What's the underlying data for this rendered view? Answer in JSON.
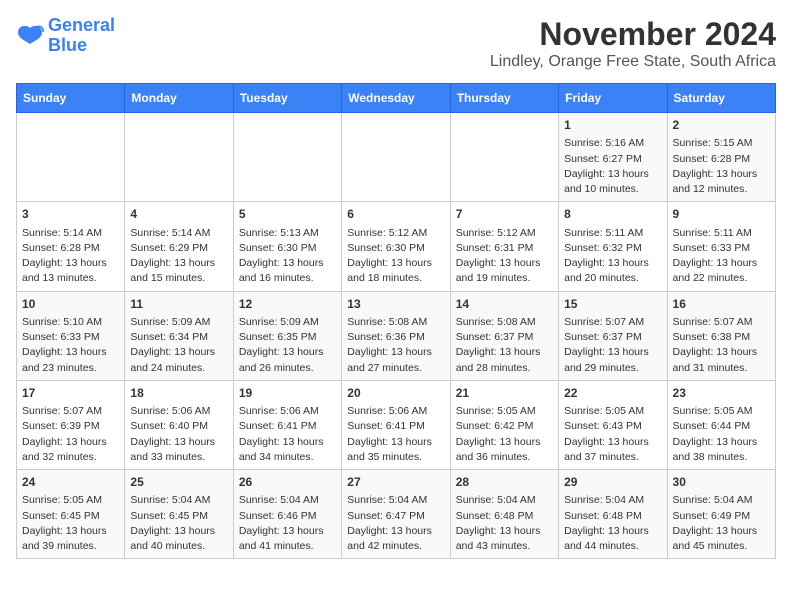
{
  "logo": {
    "line1": "General",
    "line2": "Blue"
  },
  "title": "November 2024",
  "subtitle": "Lindley, Orange Free State, South Africa",
  "days_of_week": [
    "Sunday",
    "Monday",
    "Tuesday",
    "Wednesday",
    "Thursday",
    "Friday",
    "Saturday"
  ],
  "weeks": [
    [
      {
        "day": "",
        "content": ""
      },
      {
        "day": "",
        "content": ""
      },
      {
        "day": "",
        "content": ""
      },
      {
        "day": "",
        "content": ""
      },
      {
        "day": "",
        "content": ""
      },
      {
        "day": "1",
        "content": "Sunrise: 5:16 AM\nSunset: 6:27 PM\nDaylight: 13 hours\nand 10 minutes."
      },
      {
        "day": "2",
        "content": "Sunrise: 5:15 AM\nSunset: 6:28 PM\nDaylight: 13 hours\nand 12 minutes."
      }
    ],
    [
      {
        "day": "3",
        "content": "Sunrise: 5:14 AM\nSunset: 6:28 PM\nDaylight: 13 hours\nand 13 minutes."
      },
      {
        "day": "4",
        "content": "Sunrise: 5:14 AM\nSunset: 6:29 PM\nDaylight: 13 hours\nand 15 minutes."
      },
      {
        "day": "5",
        "content": "Sunrise: 5:13 AM\nSunset: 6:30 PM\nDaylight: 13 hours\nand 16 minutes."
      },
      {
        "day": "6",
        "content": "Sunrise: 5:12 AM\nSunset: 6:30 PM\nDaylight: 13 hours\nand 18 minutes."
      },
      {
        "day": "7",
        "content": "Sunrise: 5:12 AM\nSunset: 6:31 PM\nDaylight: 13 hours\nand 19 minutes."
      },
      {
        "day": "8",
        "content": "Sunrise: 5:11 AM\nSunset: 6:32 PM\nDaylight: 13 hours\nand 20 minutes."
      },
      {
        "day": "9",
        "content": "Sunrise: 5:11 AM\nSunset: 6:33 PM\nDaylight: 13 hours\nand 22 minutes."
      }
    ],
    [
      {
        "day": "10",
        "content": "Sunrise: 5:10 AM\nSunset: 6:33 PM\nDaylight: 13 hours\nand 23 minutes."
      },
      {
        "day": "11",
        "content": "Sunrise: 5:09 AM\nSunset: 6:34 PM\nDaylight: 13 hours\nand 24 minutes."
      },
      {
        "day": "12",
        "content": "Sunrise: 5:09 AM\nSunset: 6:35 PM\nDaylight: 13 hours\nand 26 minutes."
      },
      {
        "day": "13",
        "content": "Sunrise: 5:08 AM\nSunset: 6:36 PM\nDaylight: 13 hours\nand 27 minutes."
      },
      {
        "day": "14",
        "content": "Sunrise: 5:08 AM\nSunset: 6:37 PM\nDaylight: 13 hours\nand 28 minutes."
      },
      {
        "day": "15",
        "content": "Sunrise: 5:07 AM\nSunset: 6:37 PM\nDaylight: 13 hours\nand 29 minutes."
      },
      {
        "day": "16",
        "content": "Sunrise: 5:07 AM\nSunset: 6:38 PM\nDaylight: 13 hours\nand 31 minutes."
      }
    ],
    [
      {
        "day": "17",
        "content": "Sunrise: 5:07 AM\nSunset: 6:39 PM\nDaylight: 13 hours\nand 32 minutes."
      },
      {
        "day": "18",
        "content": "Sunrise: 5:06 AM\nSunset: 6:40 PM\nDaylight: 13 hours\nand 33 minutes."
      },
      {
        "day": "19",
        "content": "Sunrise: 5:06 AM\nSunset: 6:41 PM\nDaylight: 13 hours\nand 34 minutes."
      },
      {
        "day": "20",
        "content": "Sunrise: 5:06 AM\nSunset: 6:41 PM\nDaylight: 13 hours\nand 35 minutes."
      },
      {
        "day": "21",
        "content": "Sunrise: 5:05 AM\nSunset: 6:42 PM\nDaylight: 13 hours\nand 36 minutes."
      },
      {
        "day": "22",
        "content": "Sunrise: 5:05 AM\nSunset: 6:43 PM\nDaylight: 13 hours\nand 37 minutes."
      },
      {
        "day": "23",
        "content": "Sunrise: 5:05 AM\nSunset: 6:44 PM\nDaylight: 13 hours\nand 38 minutes."
      }
    ],
    [
      {
        "day": "24",
        "content": "Sunrise: 5:05 AM\nSunset: 6:45 PM\nDaylight: 13 hours\nand 39 minutes."
      },
      {
        "day": "25",
        "content": "Sunrise: 5:04 AM\nSunset: 6:45 PM\nDaylight: 13 hours\nand 40 minutes."
      },
      {
        "day": "26",
        "content": "Sunrise: 5:04 AM\nSunset: 6:46 PM\nDaylight: 13 hours\nand 41 minutes."
      },
      {
        "day": "27",
        "content": "Sunrise: 5:04 AM\nSunset: 6:47 PM\nDaylight: 13 hours\nand 42 minutes."
      },
      {
        "day": "28",
        "content": "Sunrise: 5:04 AM\nSunset: 6:48 PM\nDaylight: 13 hours\nand 43 minutes."
      },
      {
        "day": "29",
        "content": "Sunrise: 5:04 AM\nSunset: 6:48 PM\nDaylight: 13 hours\nand 44 minutes."
      },
      {
        "day": "30",
        "content": "Sunrise: 5:04 AM\nSunset: 6:49 PM\nDaylight: 13 hours\nand 45 minutes."
      }
    ]
  ]
}
